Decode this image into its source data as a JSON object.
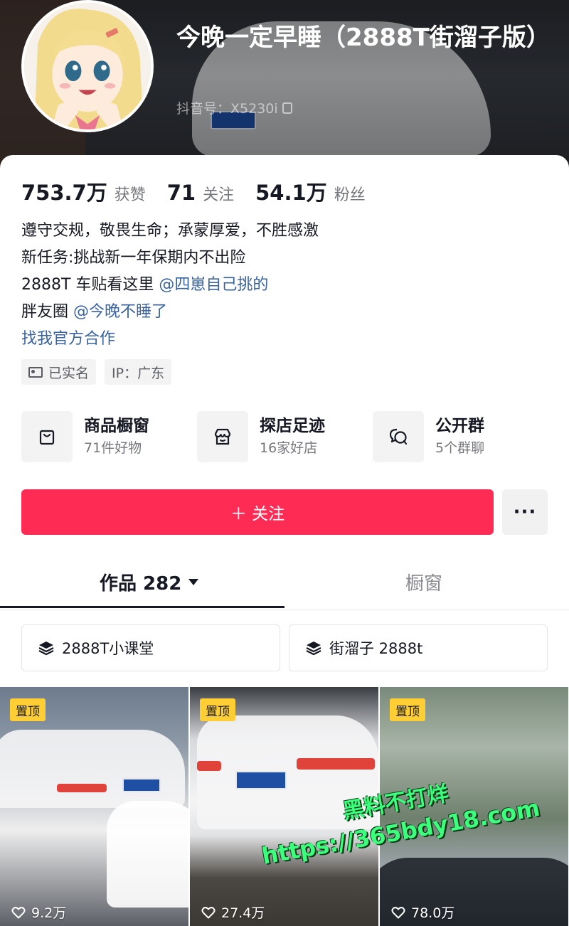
{
  "profile": {
    "nickname": "今晚一定早睡（2888T街溜子版）",
    "douyin_id": "抖音号：X5230i"
  },
  "stats": {
    "likes_value": "753.7万",
    "likes_label": "获赞",
    "following_value": "71",
    "following_label": "关注",
    "followers_value": "54.1万",
    "followers_label": "粉丝"
  },
  "bio": {
    "line1": "遵守交规，敬畏生命；承蒙厚爱，不胜感激",
    "line2": "新任务:挑战新一年保期内不出险",
    "line3_text": "2888T 车贴看这里 ",
    "line3_mention": "@四崽自己挑的",
    "line4_text": "胖友圈 ",
    "line4_mention": "@今晚不睡了",
    "cooperation_link": "找我官方合作"
  },
  "tags": {
    "verified": "已实名",
    "ip": "IP：广东"
  },
  "services": [
    {
      "title": "商品橱窗",
      "subtitle": "71件好物",
      "icon": "shopping-bag-icon"
    },
    {
      "title": "探店足迹",
      "subtitle": "16家好店",
      "icon": "storefront-icon"
    },
    {
      "title": "公开群",
      "subtitle": "5个群聊",
      "icon": "chat-bubbles-icon"
    }
  ],
  "actions": {
    "follow_label": "＋ 关注",
    "more_label": "···"
  },
  "tabs": {
    "works_label": "作品 282",
    "showcase_label": "橱窗"
  },
  "collections": [
    {
      "label": "2888T小课堂"
    },
    {
      "label": "街溜子 2888t"
    }
  ],
  "videos": [
    {
      "pinned_label": "置顶",
      "likes": "9.2万"
    },
    {
      "pinned_label": "置顶",
      "likes": "27.4万"
    },
    {
      "pinned_label": "置顶",
      "likes": "78.0万"
    }
  ],
  "watermark": {
    "line1": "黑料不打烊",
    "line2": "https://365bdy18.com"
  },
  "colors": {
    "follow_button": "#fe2c55",
    "link": "#3a63a0",
    "pin_badge": "#ffce34",
    "watermark": "#3cff7e"
  }
}
